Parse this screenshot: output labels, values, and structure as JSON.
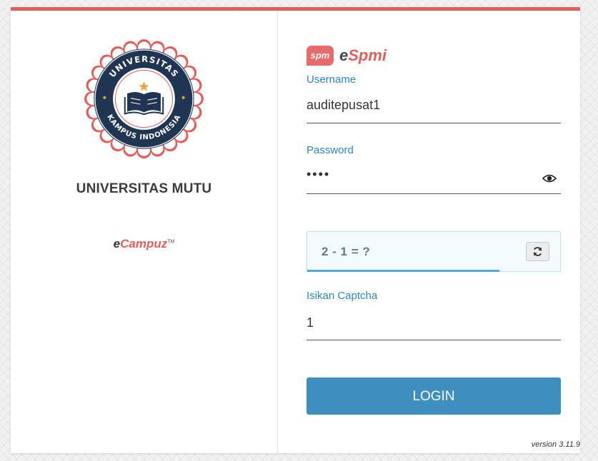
{
  "university": {
    "name": "UNIVERSITAS MUTU",
    "seal_top_text": "UNIVERSITAS",
    "seal_bottom_text": "KAMPUS INDONESIA"
  },
  "vendor": {
    "prefix": "e",
    "name": "Campuz",
    "trademark": "TM"
  },
  "brand": {
    "badge": "spm",
    "name_prefix": "e",
    "name_rest": "Spmi"
  },
  "form": {
    "username_label": "Username",
    "username_value": "auditepusat1",
    "password_label": "Password",
    "password_masked": "••••",
    "captcha_question": "2 - 1 = ?",
    "captcha_progress": 0.76,
    "captcha_label": "Isikan Captcha",
    "captcha_value": "1",
    "login_label": "LOGIN"
  },
  "version": "version 3.11.9",
  "colors": {
    "accent_red": "#e35d5b",
    "primary_blue": "#3e8fbf",
    "label_blue": "#2b86c5",
    "seal_navy": "#1f3552"
  },
  "icons": [
    "eye-icon",
    "refresh-icon",
    "book-icon",
    "star-icon"
  ]
}
